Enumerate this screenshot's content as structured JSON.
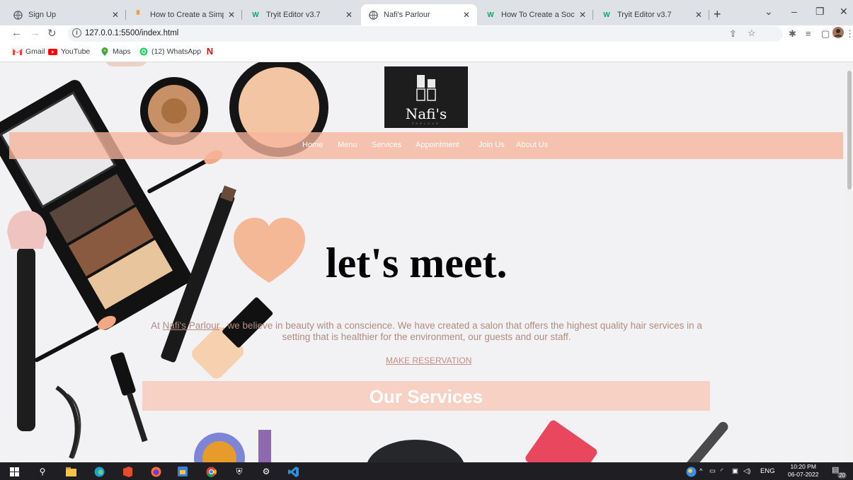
{
  "browser": {
    "tabs": [
      {
        "title": "Sign Up",
        "active": false,
        "favicon": "globe-icon"
      },
      {
        "title": "How to Create a Simple Log",
        "active": false,
        "favicon": "page-icon"
      },
      {
        "title": "Tryit Editor v3.7",
        "active": false,
        "favicon": "w3schools-icon"
      },
      {
        "title": "Nafi's Parlour",
        "active": true,
        "favicon": "globe-icon"
      },
      {
        "title": "How To Create a Social Me",
        "active": false,
        "favicon": "w3schools-icon"
      },
      {
        "title": "Tryit Editor v3.7",
        "active": false,
        "favicon": "w3schools-icon"
      }
    ],
    "url": "127.0.0.1:5500/index.html",
    "bookmarks": [
      {
        "label": "Gmail",
        "icon": "gmail-icon"
      },
      {
        "label": "YouTube",
        "icon": "youtube-icon"
      },
      {
        "label": "Maps",
        "icon": "maps-icon"
      },
      {
        "label": "(12) WhatsApp",
        "icon": "whatsapp-icon"
      },
      {
        "label": "",
        "icon": "netflix-icon"
      }
    ]
  },
  "page": {
    "logo": {
      "name": "Nafi's",
      "sub": "PARLOUR"
    },
    "nav": [
      "Home",
      "Menu",
      "Services",
      "Appointment",
      "Join Us",
      "About Us"
    ],
    "hero": {
      "title": "let's meet.",
      "desc_prefix": "At ",
      "brand": "Nafi's Parlour",
      "desc_suffix": " , we believe in beauty with a conscience. We have created a salon that offers the highest quality hair services in a setting that is healthier for the environment, our guests and our staff.",
      "reserve": "MAKE RESERVATION"
    },
    "services_title": "Our Services"
  },
  "taskbar": {
    "tray_lang": "ENG",
    "time": "10:20 PM",
    "date": "06-07-2022",
    "notifications": "20"
  },
  "colors": {
    "nav_band": "#f6b59c",
    "services_band": "#f6c4b2",
    "logo_bg": "#1d1d1d",
    "reserve_link": "#c38d86"
  }
}
